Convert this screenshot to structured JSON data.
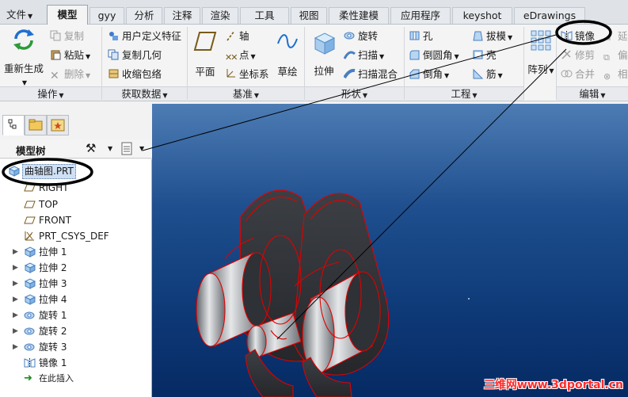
{
  "menu": {
    "file_label": "文件",
    "tabs": [
      {
        "label": "模型",
        "active": true
      },
      {
        "label": "gyy"
      },
      {
        "label": "分析"
      },
      {
        "label": "注释"
      },
      {
        "label": "渲染"
      },
      {
        "label": "工具"
      },
      {
        "label": "视图"
      },
      {
        "label": "柔性建模"
      },
      {
        "label": "应用程序"
      },
      {
        "label": "keyshot"
      },
      {
        "label": "eDrawings"
      }
    ]
  },
  "ribbon": {
    "operations": {
      "label": "操作",
      "regenerate": "重新生成",
      "copy": "复制",
      "paste": "粘贴",
      "delete": "删除"
    },
    "get_data": {
      "label": "获取数据",
      "udf": "用户定义特征",
      "copy_geometry": "复制几何",
      "shrinkwrap": "收缩包络"
    },
    "datum": {
      "label": "基准",
      "plane": "平面",
      "axis": "轴",
      "point": "点",
      "csys": "坐标系",
      "sketch": "草绘"
    },
    "shapes": {
      "label": "形状",
      "extrude": "拉伸",
      "revolve": "旋转",
      "sweep": "扫描",
      "swept_blend": "扫描混合"
    },
    "engineering": {
      "label": "工程",
      "hole": "孔",
      "round": "倒圆角",
      "chamfer": "倒角",
      "draft": "拔模",
      "shell": "壳",
      "rib": "筋"
    },
    "pattern": {
      "label": "阵列"
    },
    "editing": {
      "label": "编辑",
      "mirror": "镜像",
      "trim": "修剪",
      "merge": "合并",
      "extend": "延",
      "offset": "偏",
      "intersect": "相"
    }
  },
  "model_tree": {
    "title": "模型树",
    "items": [
      {
        "label": "曲轴图.PRT",
        "type": "part"
      },
      {
        "label": "RIGHT",
        "type": "plane"
      },
      {
        "label": "TOP",
        "type": "plane"
      },
      {
        "label": "FRONT",
        "type": "plane"
      },
      {
        "label": "PRT_CSYS_DEF",
        "type": "csys"
      },
      {
        "label": "拉伸 1",
        "type": "extrude"
      },
      {
        "label": "拉伸 2",
        "type": "extrude"
      },
      {
        "label": "拉伸 3",
        "type": "extrude"
      },
      {
        "label": "拉伸 4",
        "type": "extrude"
      },
      {
        "label": "旋转 1",
        "type": "revolve"
      },
      {
        "label": "旋转 2",
        "type": "revolve"
      },
      {
        "label": "旋转 3",
        "type": "revolve"
      },
      {
        "label": "镜像 1",
        "type": "mirror"
      },
      {
        "label": "在此插入",
        "type": "insert"
      }
    ]
  },
  "watermark": "三维网www.3dportal.cn",
  "colors": {
    "annotation": "#000000",
    "wire": "#e00000",
    "insert_arrow": "#1a8a1a"
  }
}
